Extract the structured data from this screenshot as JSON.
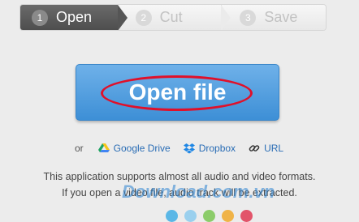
{
  "steps": [
    {
      "num": "1",
      "label": "Open"
    },
    {
      "num": "2",
      "label": "Cut"
    },
    {
      "num": "3",
      "label": "Save"
    }
  ],
  "open_button": {
    "label": "Open file"
  },
  "sources": {
    "or": "or",
    "items": [
      {
        "label": "Google Drive",
        "icon": "google-drive-icon"
      },
      {
        "label": "Dropbox",
        "icon": "dropbox-icon"
      },
      {
        "label": "URL",
        "icon": "link-icon"
      }
    ]
  },
  "note": {
    "line1": "This application supports almost all audio and video formats.",
    "line2": "If you open a video file, audio track will be extracted."
  },
  "watermark": "Download.com.vn",
  "colors": {
    "accent": "#3d8fd6",
    "highlight_ring": "#e0102a",
    "dots": [
      "#5bb7e6",
      "#9ad0ee",
      "#8ccc6a",
      "#f0b347",
      "#e2546a",
      "#d8363f"
    ]
  }
}
